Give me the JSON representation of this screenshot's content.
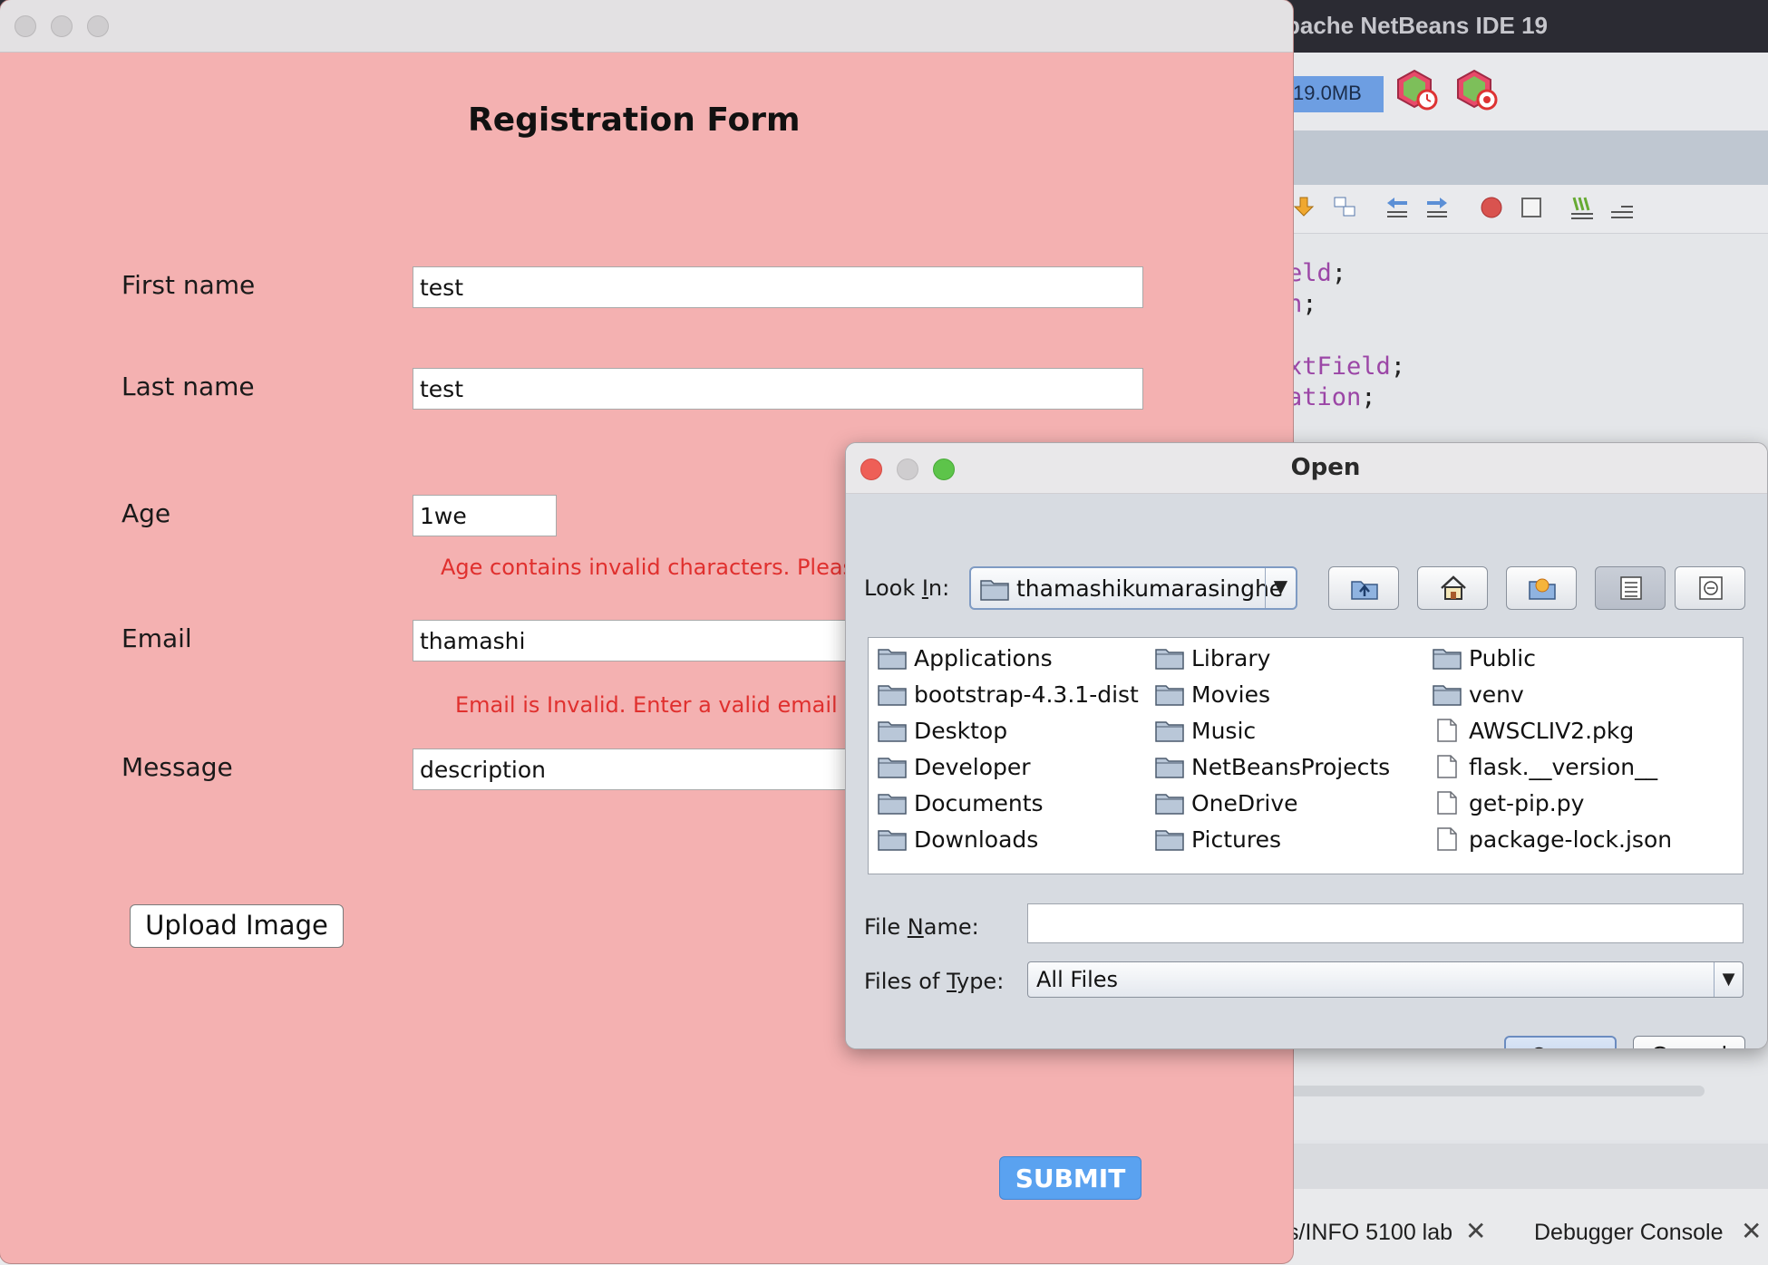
{
  "ide": {
    "title": "pache NetBeans IDE 19",
    "memory": "19.0MB",
    "code_lines": [
      {
        "frag": "eld",
        "semi": ";"
      },
      {
        "frag": "n",
        "semi": ";"
      },
      {
        "frag": "xtField",
        "semi": ";"
      },
      {
        "frag": "ation",
        "semi": ";"
      }
    ],
    "bottom_tabs": [
      "s/INFO 5100 lab",
      "Debugger Console"
    ],
    "close_glyph": "✕"
  },
  "form": {
    "heading": "Registration Form",
    "fields": {
      "first_name": {
        "label": "First name",
        "value": "test"
      },
      "last_name": {
        "label": "Last name",
        "value": "test"
      },
      "age": {
        "label": "Age",
        "value": "1we"
      },
      "email": {
        "label": "Email",
        "value": "thamashi"
      },
      "message": {
        "label": "Message",
        "value": "description"
      }
    },
    "errors": {
      "age": "Age contains invalid characters. Please",
      "email": "Email is Invalid. Enter a valid email"
    },
    "upload_label": "Upload Image",
    "submit_label": "SUBMIT"
  },
  "dialog": {
    "title": "Open",
    "look_in_label_pre": "Look ",
    "look_in_label_u": "I",
    "look_in_label_post": "n:",
    "look_in_value": "thamashikumarasinghe",
    "toolbar_icons": [
      "up-folder-icon",
      "home-icon",
      "new-folder-icon",
      "list-view-icon",
      "details-view-icon"
    ],
    "files": [
      {
        "name": "Applications",
        "type": "folder"
      },
      {
        "name": "bootstrap-4.3.1-dist",
        "type": "folder"
      },
      {
        "name": "Desktop",
        "type": "folder"
      },
      {
        "name": "Developer",
        "type": "folder"
      },
      {
        "name": "Documents",
        "type": "folder"
      },
      {
        "name": "Downloads",
        "type": "folder"
      },
      {
        "name": "Library",
        "type": "folder"
      },
      {
        "name": "Movies",
        "type": "folder"
      },
      {
        "name": "Music",
        "type": "folder"
      },
      {
        "name": "NetBeansProjects",
        "type": "folder"
      },
      {
        "name": "OneDrive",
        "type": "folder"
      },
      {
        "name": "Pictures",
        "type": "folder"
      },
      {
        "name": "Public",
        "type": "folder"
      },
      {
        "name": "venv",
        "type": "folder"
      },
      {
        "name": "AWSCLIV2.pkg",
        "type": "file"
      },
      {
        "name": "flask.__version__",
        "type": "file"
      },
      {
        "name": "get-pip.py",
        "type": "file"
      },
      {
        "name": "package-lock.json",
        "type": "file"
      }
    ],
    "file_name_label_pre": "File ",
    "file_name_label_u": "N",
    "file_name_label_post": "ame:",
    "file_name_value": "",
    "files_of_type_label_pre": "Files of ",
    "files_of_type_label_u": "T",
    "files_of_type_label_post": "ype:",
    "files_of_type_value": "All Files",
    "open_label": "Open",
    "cancel_label": "Cancel"
  }
}
